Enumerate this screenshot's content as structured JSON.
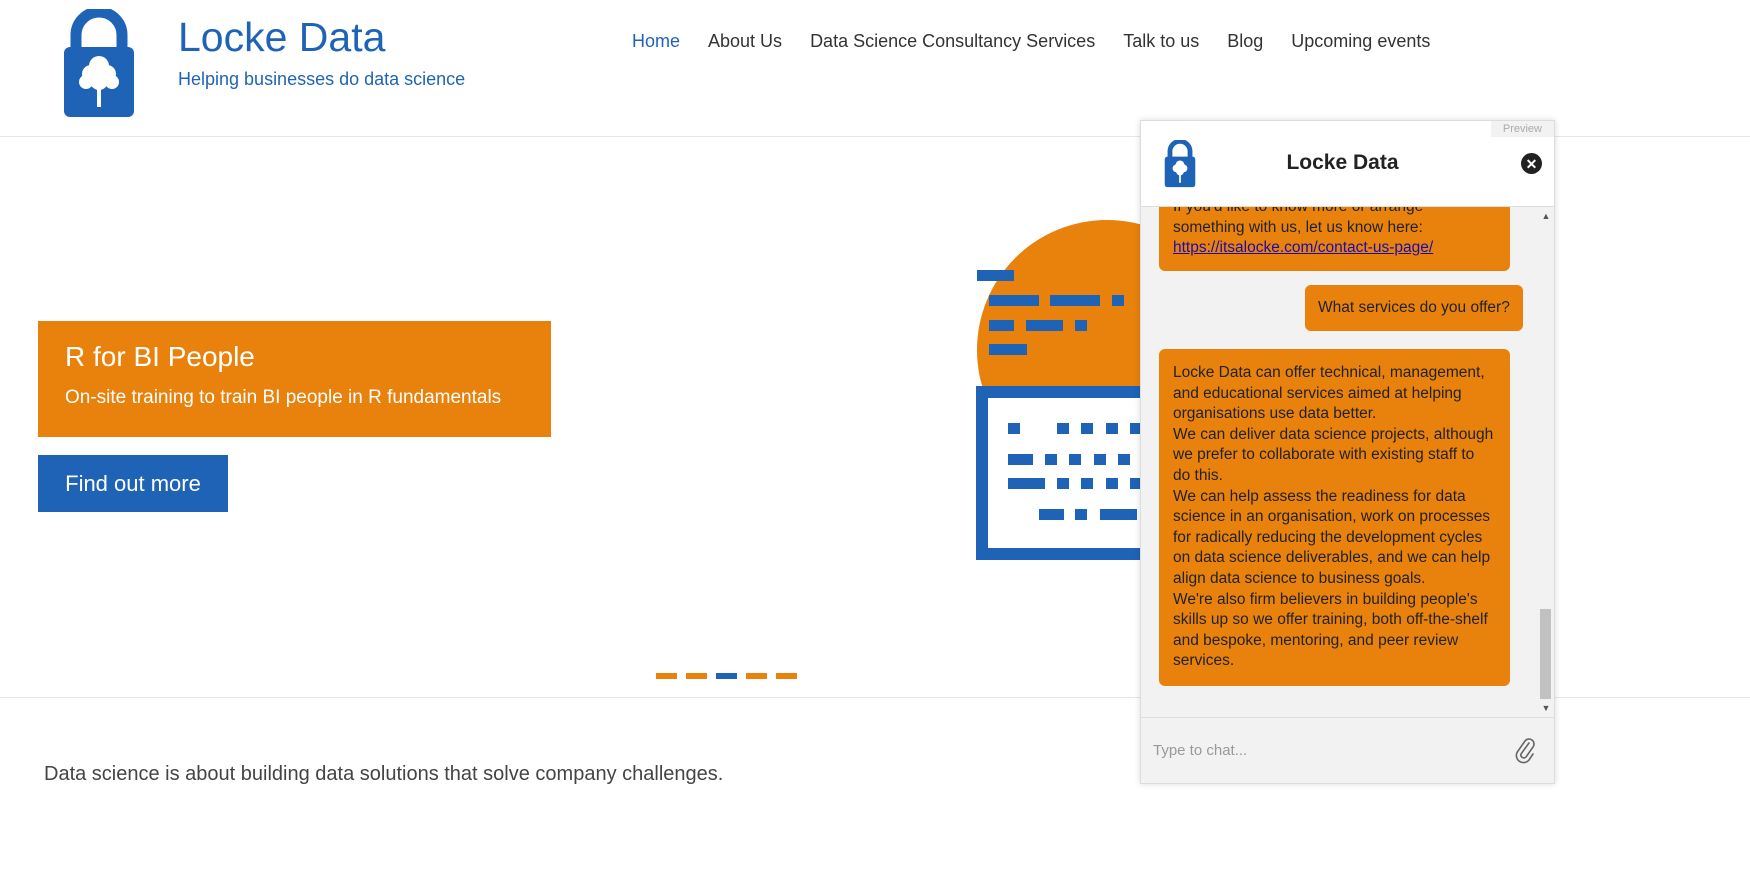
{
  "header": {
    "brand_title": "Locke Data",
    "brand_tagline": "Helping businesses do data science",
    "logo_icon": "padlock-tree-icon"
  },
  "nav": [
    {
      "label": "Home",
      "active": true
    },
    {
      "label": "About Us",
      "active": false
    },
    {
      "label": "Data Science Consultancy Services",
      "active": false
    },
    {
      "label": "Talk to us",
      "active": false
    },
    {
      "label": "Blog",
      "active": false
    },
    {
      "label": "Upcoming events",
      "active": false
    }
  ],
  "hero": {
    "title": "R for BI People",
    "subtitle": "On-site training to train BI people in R fundamentals",
    "button": "Find out more",
    "slide_count": 5,
    "active_slide": 3
  },
  "intro": "Data science is about building data solutions that solve company challenges.",
  "chat": {
    "preview_label": "Preview",
    "title": "Locke Data",
    "close_icon": "close-icon",
    "messages": {
      "bot1_line1": "If you'd like to know more or arrange",
      "bot1_line2": "something with us, let us know here:",
      "bot1_link": "https://itsalocke.com/contact-us-page/",
      "user1": "What services do you offer?",
      "bot2_lines": [
        "Locke Data can offer technical, management,",
        "and educational services aimed at helping",
        "organisations use data better.",
        "We can deliver data science projects, although",
        "we prefer to collaborate with existing staff to",
        "do this.",
        "We can help assess the readiness for data",
        "science in an organisation, work on processes",
        "for radically reducing the development cycles",
        "on data science deliverables, and we can help",
        "align data science to business goals.",
        "We're also firm believers in building people's",
        "skills up so we offer training, both off-the-shelf",
        "and bespoke, mentoring, and peer review",
        "services."
      ]
    },
    "input_placeholder": "Type to chat...",
    "attach_icon": "paperclip-icon"
  },
  "colors": {
    "brand_blue": "#1f63b6",
    "brand_orange": "#e8820c"
  }
}
